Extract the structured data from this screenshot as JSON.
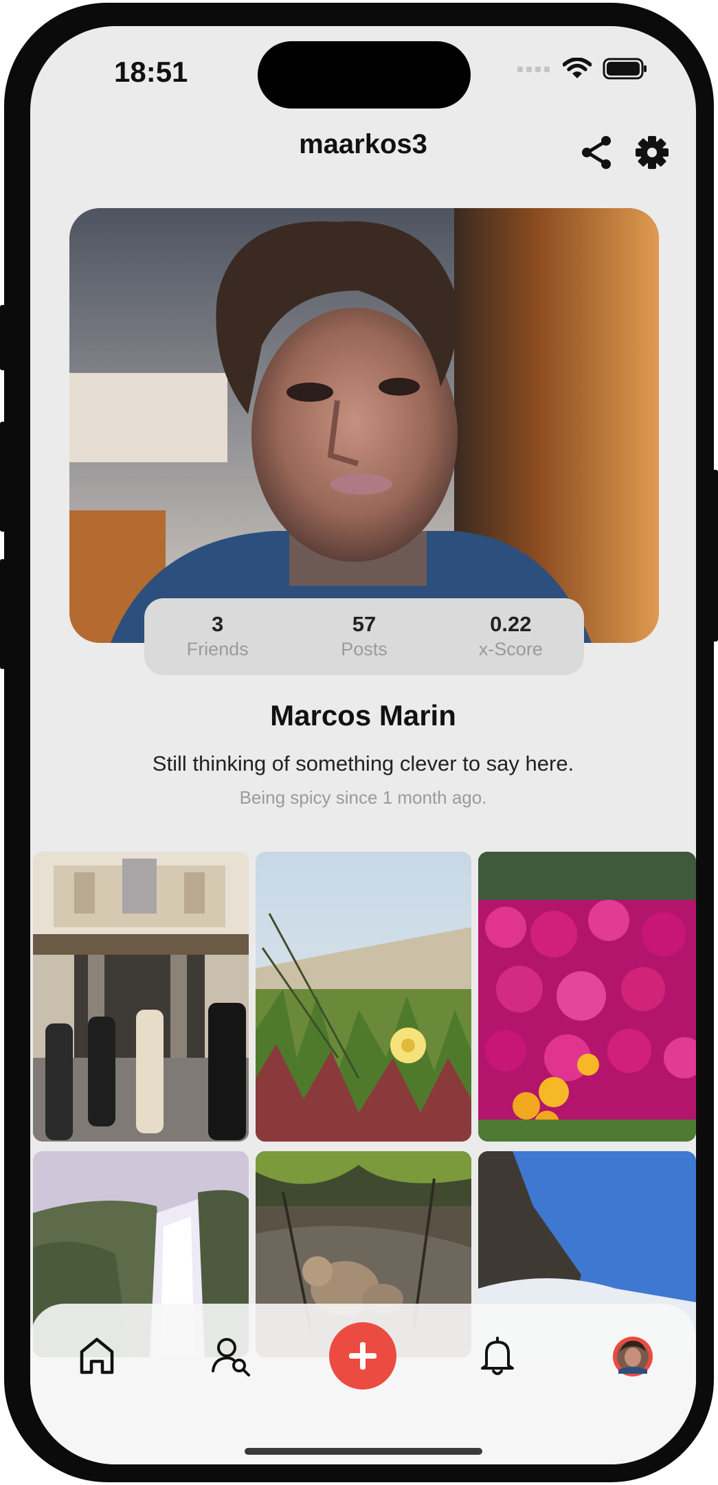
{
  "status": {
    "time": "18:51"
  },
  "header": {
    "username": "maarkos3"
  },
  "stats": [
    {
      "value": "3",
      "label": "Friends"
    },
    {
      "value": "57",
      "label": "Posts"
    },
    {
      "value": "0.22",
      "label": "x-Score"
    }
  ],
  "profile": {
    "name": "Marcos Marin",
    "bio": "Still thinking of something clever to say here.",
    "since": "Being spicy since 1 month ago."
  },
  "posts": [
    {
      "subject": "shopping-gallery"
    },
    {
      "subject": "yellow-flower-dunes"
    },
    {
      "subject": "pink-flowers"
    },
    {
      "subject": "waterfall"
    },
    {
      "subject": "monkeys"
    },
    {
      "subject": "mountain-snow"
    }
  ],
  "tabbar": {
    "items": [
      "home-icon",
      "user-search-icon",
      "plus-icon",
      "bell-icon",
      "profile-avatar"
    ],
    "accent": "#eb4b41"
  },
  "colors": {
    "background": "#ebebeb",
    "stats_bg": "#dadada",
    "accent": "#eb4b41"
  }
}
